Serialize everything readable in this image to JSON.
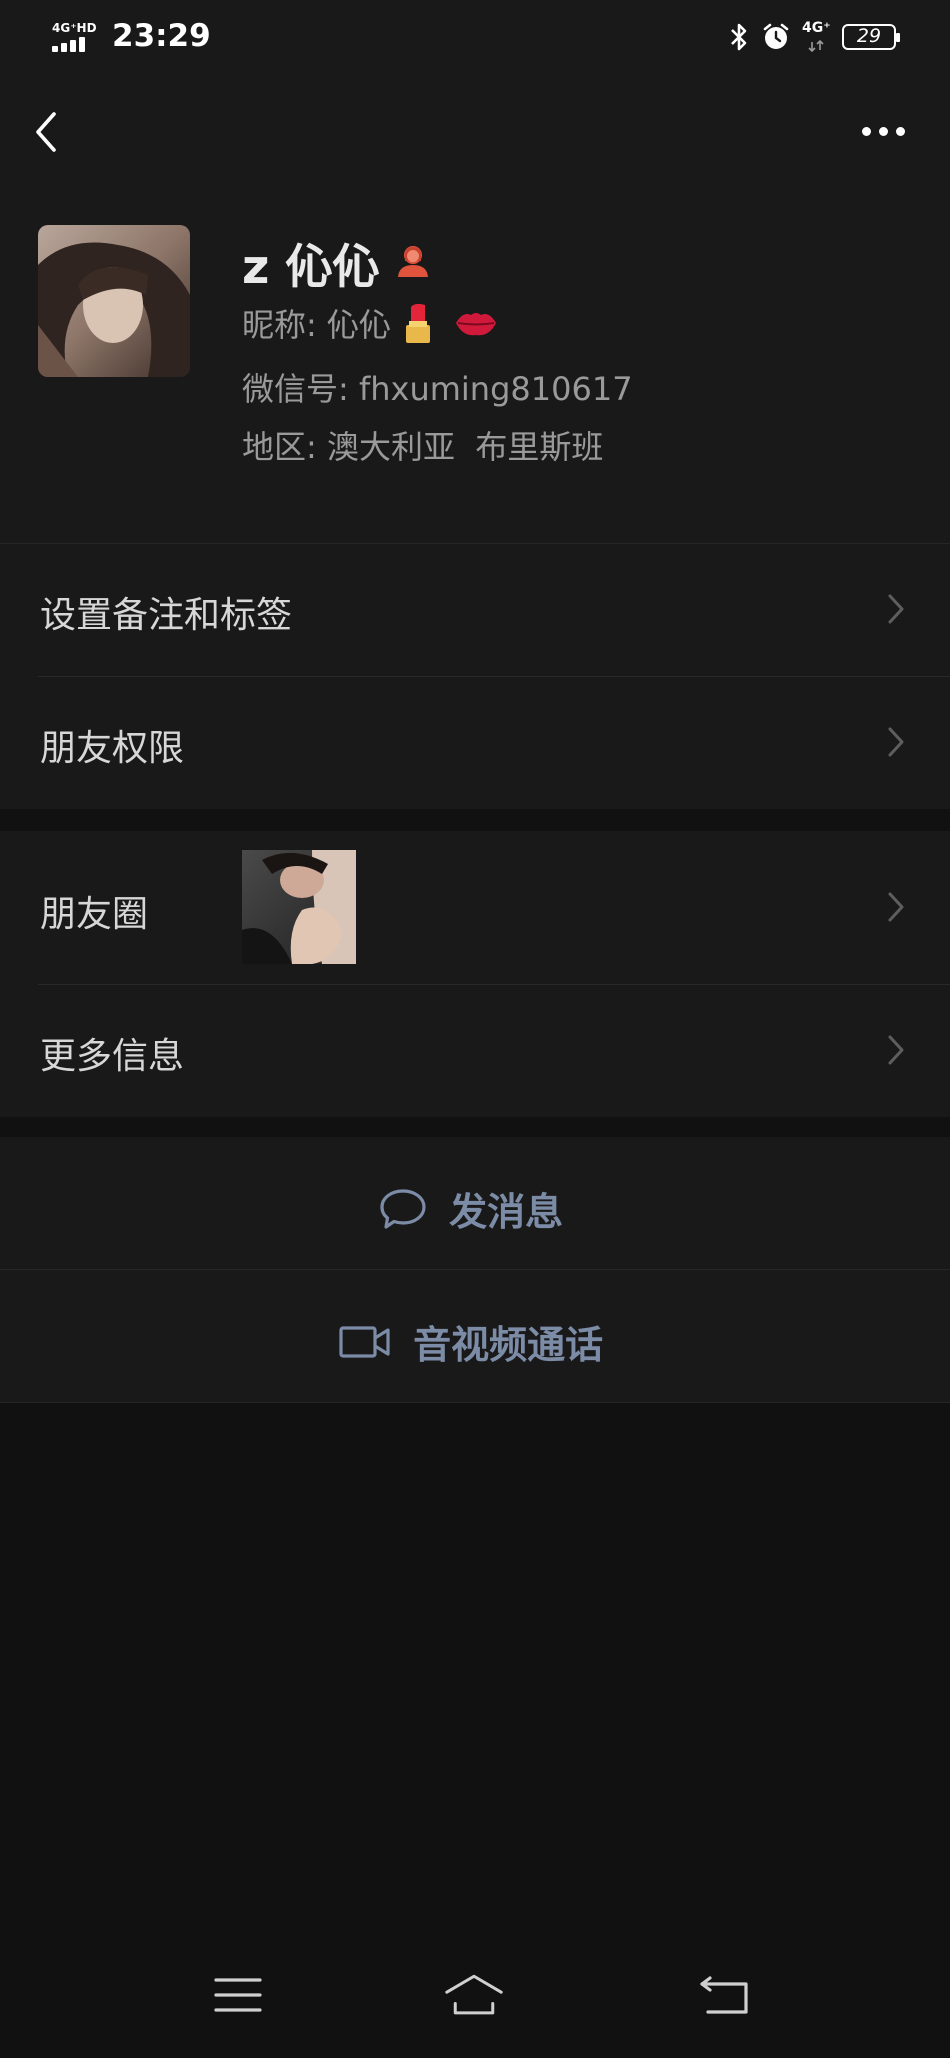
{
  "status_bar": {
    "network_label": "4G⁺HD",
    "time": "23:29",
    "network_right": "4G⁺",
    "battery": "29"
  },
  "profile": {
    "display_name": "z 伈伈",
    "nickname_label": "昵称: ",
    "nickname": "伈伈",
    "wechat_id_label": "微信号: ",
    "wechat_id": "fhxuming810617",
    "region_label": "地区: ",
    "region": "澳大利亚  布里斯班"
  },
  "menu": {
    "remark_tags": "设置备注和标签",
    "friend_permissions": "朋友权限",
    "moments": "朋友圈",
    "more_info": "更多信息"
  },
  "actions": {
    "send_message": "发消息",
    "video_call": "音视频通话"
  },
  "colors": {
    "background": "#111111",
    "panel": "#191919",
    "primary_text": "#d7d7d7",
    "secondary_text": "#9a9a9a",
    "action_text": "#7c8ca7"
  },
  "icons": {
    "back": "chevron-left-icon",
    "more": "more-dots-icon",
    "gender": "female-icon",
    "message": "chat-bubble-icon",
    "video": "video-camera-icon",
    "nav_menu": "menu-icon",
    "nav_home": "home-icon",
    "nav_back": "return-icon"
  }
}
